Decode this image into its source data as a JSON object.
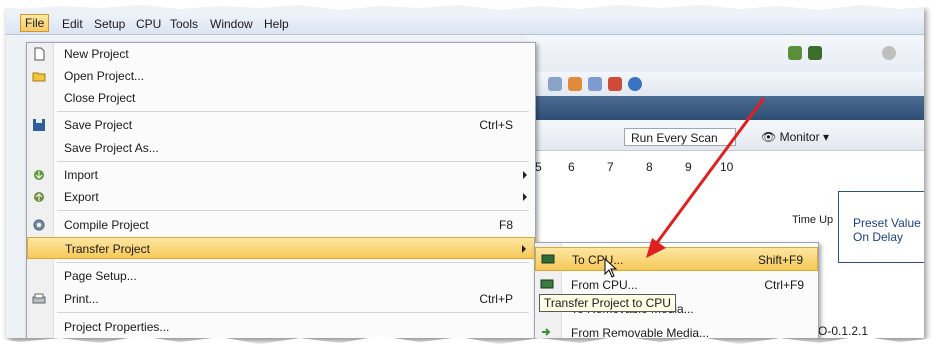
{
  "menubar": {
    "items": [
      "File",
      "Edit",
      "Setup",
      "CPU",
      "Tools",
      "Window",
      "Help"
    ]
  },
  "file_menu": {
    "items": [
      {
        "label": "New Project",
        "shortcut": "",
        "icon": "new-project-icon"
      },
      {
        "label": "Open Project...",
        "shortcut": "",
        "icon": "open-folder-icon"
      },
      {
        "label": "Close Project",
        "shortcut": "",
        "icon": ""
      },
      {
        "label": "Save Project",
        "shortcut": "Ctrl+S",
        "icon": "save-disk-icon"
      },
      {
        "label": "Save Project As...",
        "shortcut": "",
        "icon": ""
      },
      {
        "label": "Import",
        "shortcut": "",
        "icon": "import-icon",
        "submenu": true
      },
      {
        "label": "Export",
        "shortcut": "",
        "icon": "export-icon",
        "submenu": true
      },
      {
        "label": "Compile Project",
        "shortcut": "F8",
        "icon": "compile-gear-icon"
      },
      {
        "label": "Transfer Project",
        "shortcut": "",
        "icon": "",
        "submenu": true,
        "highlighted": true
      },
      {
        "label": "Page Setup...",
        "shortcut": "",
        "icon": ""
      },
      {
        "label": "Print...",
        "shortcut": "Ctrl+P",
        "icon": "printer-icon"
      },
      {
        "label": "Project Properties...",
        "shortcut": "",
        "icon": ""
      }
    ]
  },
  "transfer_submenu": {
    "items": [
      {
        "label": "To CPU...",
        "shortcut": "Shift+F9",
        "icon": "to-cpu-icon",
        "highlighted": true
      },
      {
        "label": "From CPU...",
        "shortcut": "Ctrl+F9",
        "icon": "from-cpu-icon"
      },
      {
        "label": "To Removable Media...",
        "shortcut": "",
        "icon": "to-media-icon"
      },
      {
        "label": "From Removable Media...",
        "shortcut": "",
        "icon": "from-media-icon"
      }
    ]
  },
  "tooltip": "Transfer Project to CPU",
  "background": {
    "scan_combo": "Run Every Scan",
    "monitor_label": "Monitor",
    "ruler": [
      "5",
      "6",
      "7",
      "8",
      "9",
      "10"
    ],
    "time_up": "Time Up",
    "preset_value": "Preset Value",
    "on_delay": "On Delay",
    "version_fragment": "O-0.1.2.1"
  },
  "colors": {
    "highlight": "#f6c858",
    "arrow": "#e0201e",
    "dark_band": "#2f4e73"
  }
}
